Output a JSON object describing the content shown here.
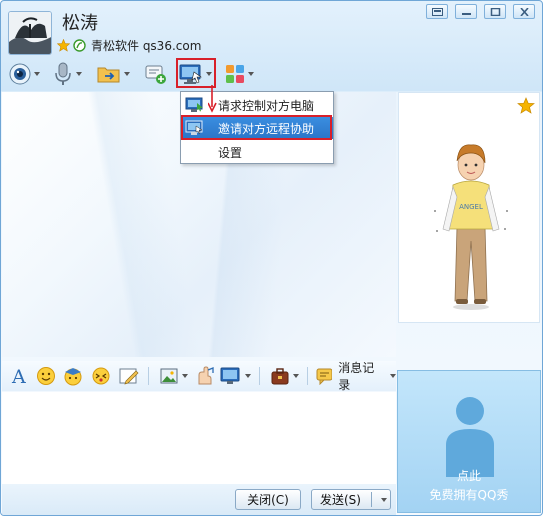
{
  "window": {
    "contact_name": "松涛",
    "contact_signature": "青松软件 qs36.com"
  },
  "toolbar": {
    "video_icon": "webcam-icon",
    "voice_icon": "microphone-icon",
    "file_icon": "folder-transfer-icon",
    "sms_icon": "message-add-icon",
    "remote_icon": "remote-desktop-icon",
    "apps_icon": "app-grid-icon"
  },
  "remote_menu": {
    "items": [
      {
        "label": "请求控制对方电脑",
        "icon": "monitor-icon"
      },
      {
        "label": "邀请对方远程协助",
        "icon": "monitor-arrow-icon"
      },
      {
        "label": "设置",
        "icon": ""
      }
    ],
    "selected_index": 1
  },
  "format_bar": {
    "msg_record_label": "消息记录"
  },
  "buttons": {
    "close_label": "关闭(C)",
    "send_label": "发送(S)"
  },
  "qqshow": {
    "line1": "点此",
    "line2": "免费拥有QQ秀"
  },
  "colors": {
    "highlight": "#2b75c8",
    "annotation_red": "#d8202a",
    "frame_blue": "#6fa6d6"
  }
}
